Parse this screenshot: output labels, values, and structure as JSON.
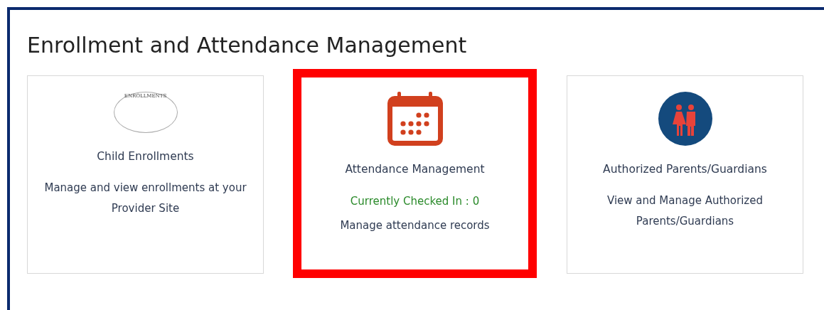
{
  "heading": "Enrollment and Attendance Management",
  "tiles": [
    {
      "kind": "enrollments",
      "icon_text": "ENROLLMENTS",
      "title": "Child Enrollments",
      "description": "Manage and view enrollments at your Provider Site",
      "highlighted": false
    },
    {
      "kind": "calendar",
      "title": "Attendance Management",
      "status": "Currently Checked In : 0",
      "description": "Manage attendance records",
      "highlighted": true
    },
    {
      "kind": "guardians",
      "title": "Authorized Parents/Guardians",
      "description": "View and Manage Authorized Parents/Guardians",
      "highlighted": false
    }
  ]
}
